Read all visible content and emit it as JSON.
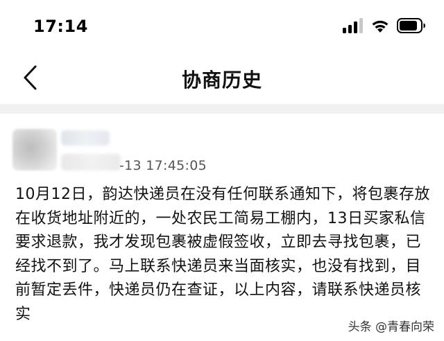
{
  "status_bar": {
    "time": "17:14",
    "icons": [
      "cellular-signal-icon",
      "wifi-icon",
      "battery-icon"
    ]
  },
  "nav": {
    "back_icon": "chevron-left-icon",
    "title": "协商历史"
  },
  "record": {
    "timestamp": "-13 17:45:05",
    "content": "10月12日，韵达快递员在没有任何联系通知下，将包裹存放在收货地址附近的，一处农民工简易工棚内，13日买家私信要求退款，我才发现包裹被虚假签收，立即去寻找包裹，已经找不到了。马上联系快递员来当面核实，也没有找到，目前暂定丢件，快递员仍在查证，以上内容，请联系快递员核实"
  },
  "watermark": {
    "text": "头条 @青春向荣"
  }
}
